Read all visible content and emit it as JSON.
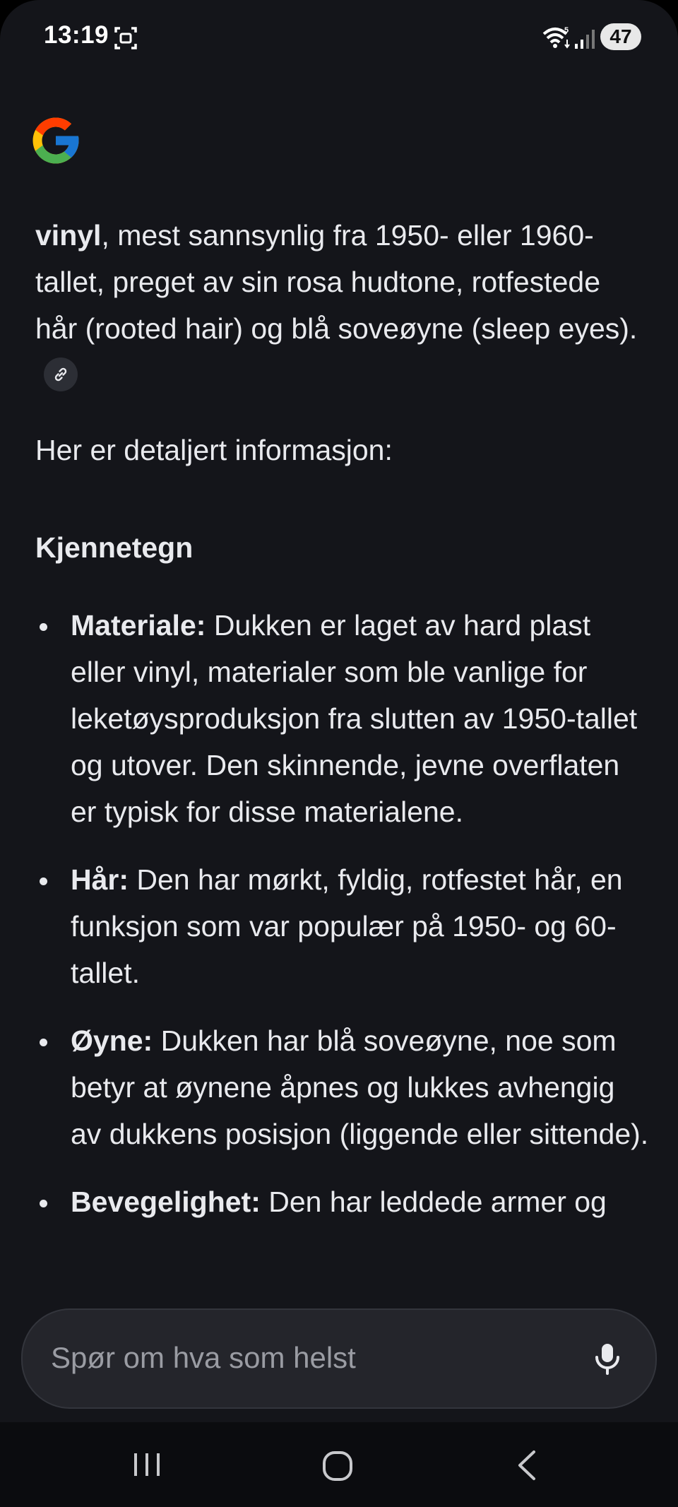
{
  "status_bar": {
    "time": "13:19",
    "battery": "47"
  },
  "answer": {
    "intro_bold": "vinyl",
    "intro_text": ", mest sannsynlig fra 1950- eller 1960-tallet, preget av sin rosa hudtone, rotfestede hår (rooted hair) og blå soveøyne (sleep eyes).",
    "lead": "Her er detaljert informasjon:",
    "heading": "Kjennetegn",
    "bullets": [
      {
        "term": "Materiale:",
        "text": " Dukken er laget av hard plast eller vinyl, materialer som ble vanlige for leketøysproduksjon fra slutten av 1950-tallet og utover. Den skinnende, jevne overflaten er typisk for disse materialene."
      },
      {
        "term": "Hår:",
        "text": " Den har mørkt, fyldig, rotfestet hår, en funksjon som var populær på 1950- og 60-tallet."
      },
      {
        "term": "Øyne:",
        "text": " Dukken har blå soveøyne, noe som betyr at øynene åpnes og lukkes avhengig av dukkens posisjon (liggende eller sittende)."
      },
      {
        "term": "Bevegelighet:",
        "text": " Den har leddede armer og"
      }
    ]
  },
  "search": {
    "placeholder": "Spør om hva som helst"
  },
  "icons": {
    "logo": "google-logo",
    "link": "link-icon",
    "mic": "mic-icon",
    "nav": [
      "recents-icon",
      "home-icon",
      "back-icon"
    ]
  }
}
